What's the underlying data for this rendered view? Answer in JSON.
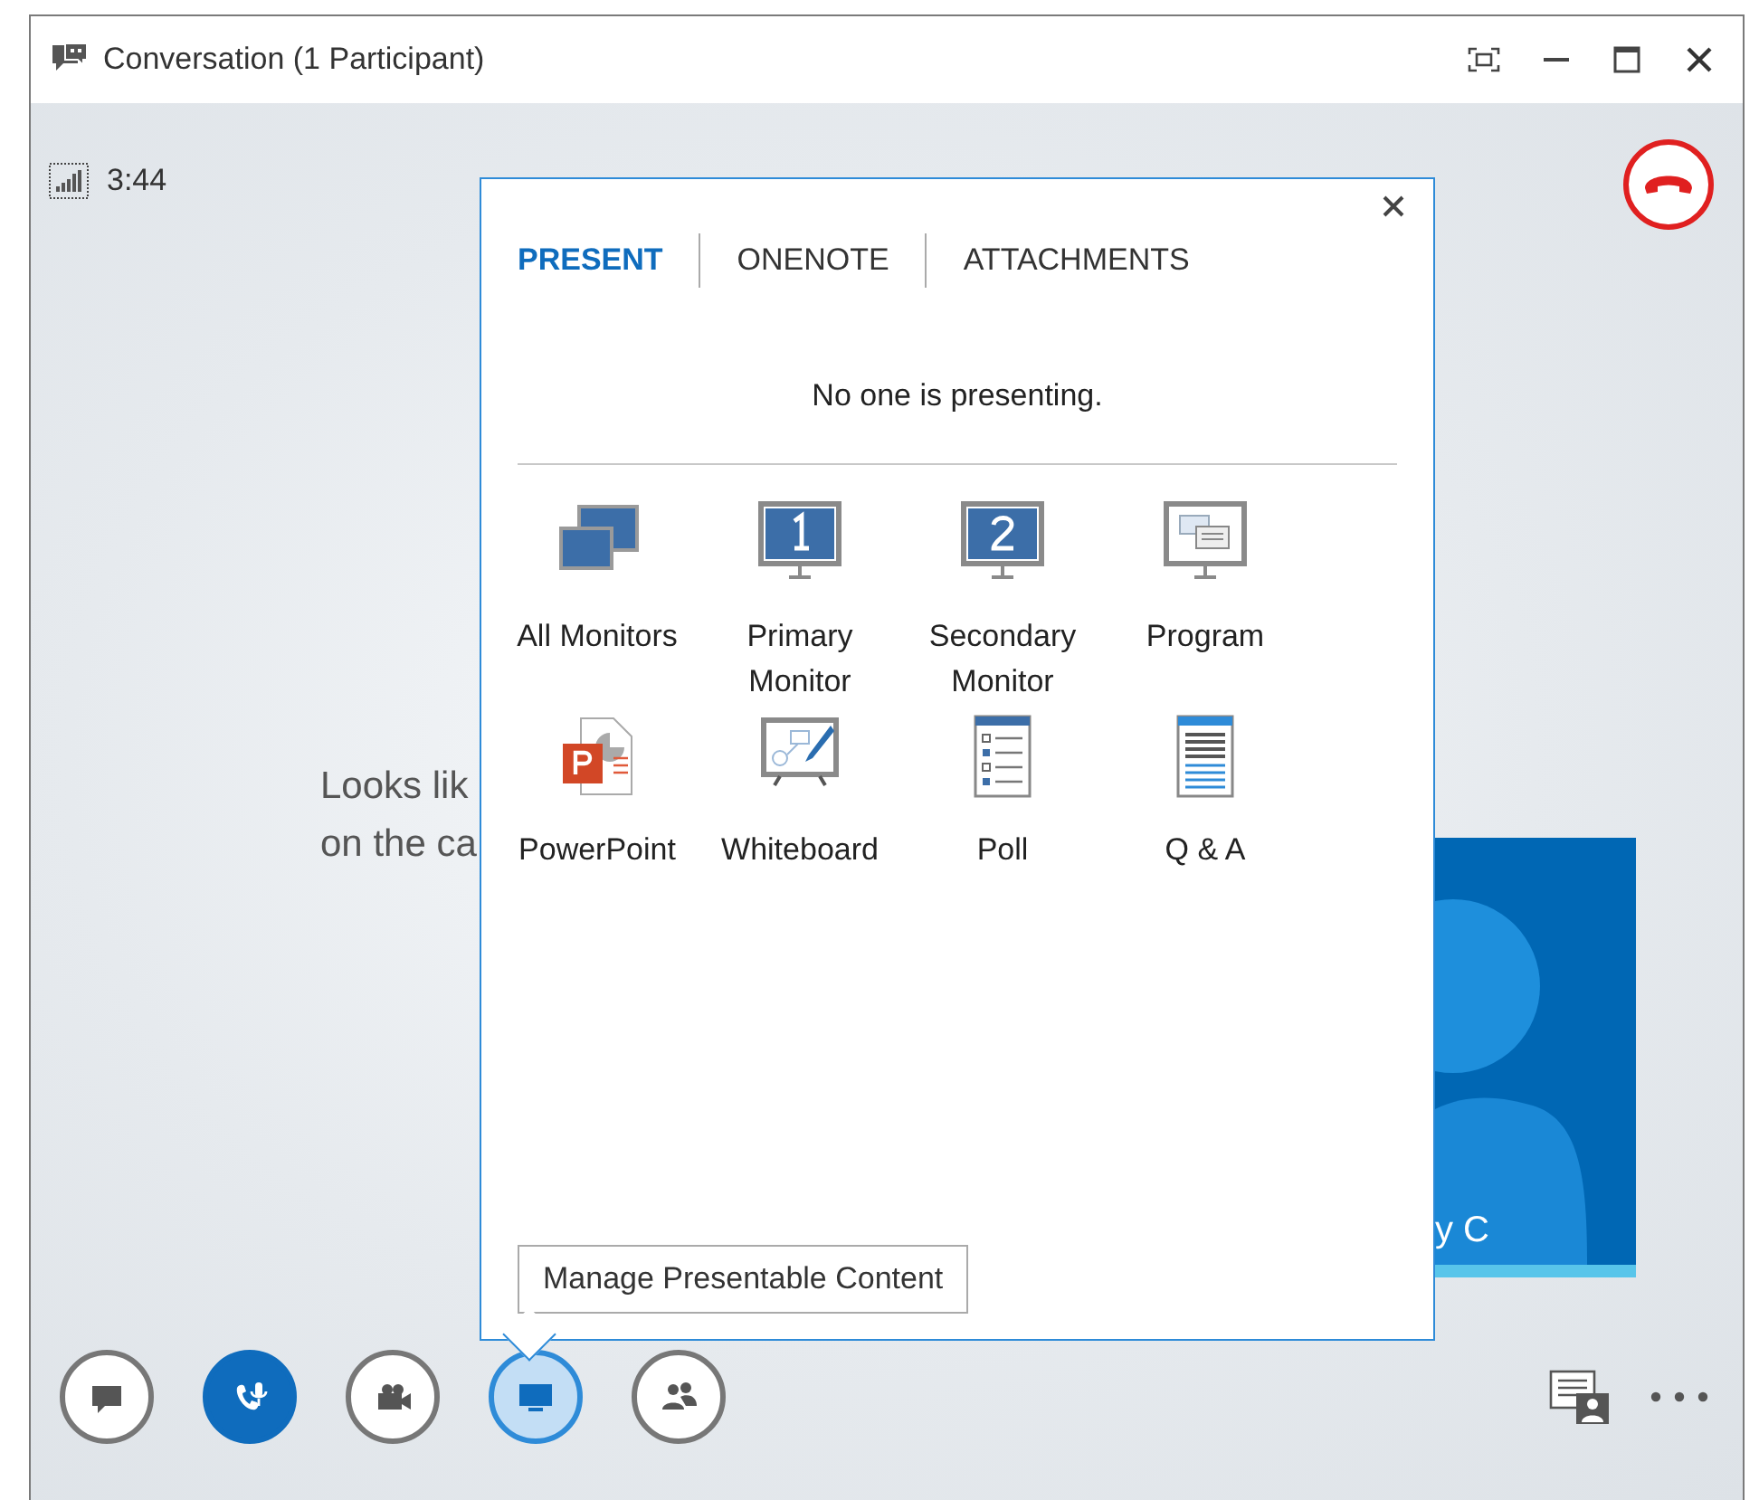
{
  "window": {
    "title": "Conversation (1 Participant)"
  },
  "call": {
    "duration": "3:44"
  },
  "stage": {
    "message_lines": [
      "Looks lik",
      "on the ca"
    ],
    "participant": {
      "name": "y C"
    }
  },
  "present_panel": {
    "tabs": [
      {
        "label": "PRESENT",
        "selected": true
      },
      {
        "label": "ONENOTE",
        "selected": false
      },
      {
        "label": "ATTACHMENTS",
        "selected": false
      }
    ],
    "status": "No one is presenting.",
    "options": [
      {
        "kind": "all-monitors",
        "label": "All Monitors"
      },
      {
        "kind": "monitor-1",
        "label": "Primary Monitor"
      },
      {
        "kind": "monitor-2",
        "label": "Secondary Monitor"
      },
      {
        "kind": "program",
        "label": "Program"
      },
      {
        "kind": "powerpoint",
        "label": "PowerPoint"
      },
      {
        "kind": "whiteboard",
        "label": "Whiteboard"
      },
      {
        "kind": "poll",
        "label": "Poll"
      },
      {
        "kind": "qa",
        "label": "Q & A"
      }
    ],
    "manage_button": "Manage Presentable Content"
  },
  "toolbar": [
    {
      "kind": "chat",
      "active": false,
      "selected": false
    },
    {
      "kind": "audio",
      "active": true,
      "selected": false
    },
    {
      "kind": "video",
      "active": false,
      "selected": false
    },
    {
      "kind": "present",
      "active": false,
      "selected": true
    },
    {
      "kind": "people",
      "active": false,
      "selected": false
    }
  ]
}
